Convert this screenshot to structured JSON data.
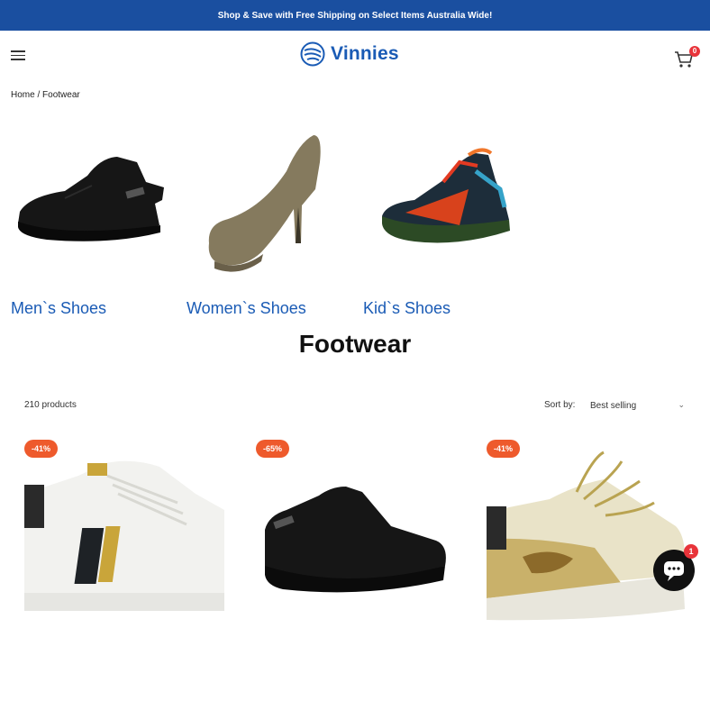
{
  "announcement": {
    "text": "Shop & Save with Free Shipping on Select Items Australia Wide!"
  },
  "header": {
    "brand": "Vinnies",
    "cart_count": "0"
  },
  "breadcrumb": {
    "home": "Home",
    "separator": "/",
    "current": "Footwear"
  },
  "categories": [
    {
      "label": "Men`s Shoes"
    },
    {
      "label": "Women`s Shoes"
    },
    {
      "label": "Kid`s Shoes"
    }
  ],
  "page": {
    "title": "Footwear"
  },
  "toolbar": {
    "count": "210 products",
    "sort_label": "Sort by:",
    "sort_value": "Best selling"
  },
  "products": [
    {
      "discount": "-41%"
    },
    {
      "discount": "-65%"
    },
    {
      "discount": "-41%"
    }
  ],
  "chat": {
    "badge": "1"
  },
  "colors": {
    "brand_blue": "#1a4fa0",
    "link_blue": "#1a5bb5",
    "discount_orange": "#ee5a2c",
    "badge_red": "#e8343a"
  }
}
